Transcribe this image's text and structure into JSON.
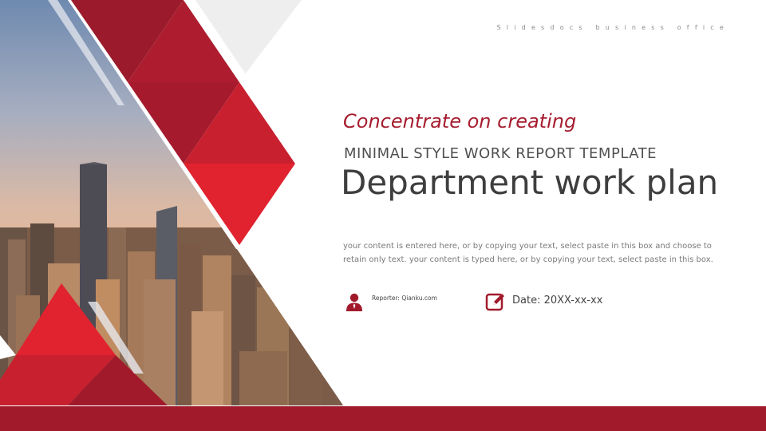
{
  "header": {
    "brand_text": "Slidesdocs business office"
  },
  "hero": {
    "tagline": "Concentrate on creating",
    "subtitle": "MINIMAL STYLE WORK REPORT TEMPLATE",
    "title": "Department work plan",
    "body": "your content is entered here, or by copying your text, select paste in this box and choose to retain only text. your content is typed here, or by copying your text, select paste in this box."
  },
  "meta": {
    "reporter": "Reporter: Qianku.com",
    "reporter_icon": "person-icon",
    "date": "Date: 20XX-xx-xx",
    "date_icon": "edit-calendar-icon"
  },
  "theme": {
    "accent": "#a11a2c",
    "accent_bright": "#e1222f",
    "text_dark": "#3e3e3e"
  }
}
